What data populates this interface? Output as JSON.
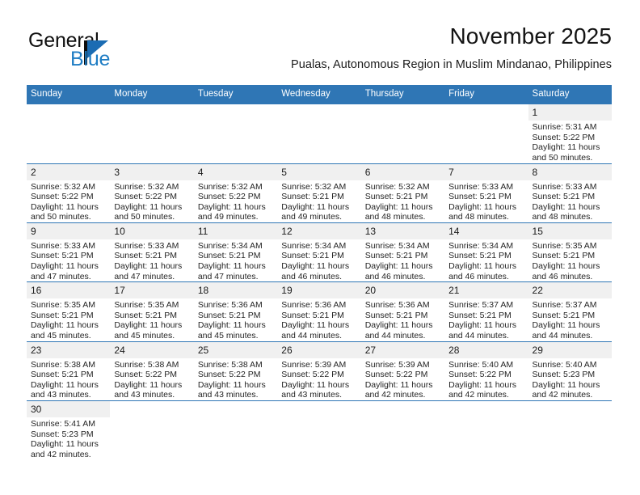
{
  "brand": {
    "name_top": "General",
    "name_bottom": "Blue",
    "flag_icon": "triangle-flag-icon",
    "accent_color": "#1b6cb3"
  },
  "header": {
    "month_title": "November 2025",
    "location": "Pualas, Autonomous Region in Muslim Mindanao, Philippines"
  },
  "calendar": {
    "header_color": "#2f76b5",
    "daynum_band_color": "#f0f0f0",
    "weekday_headers": [
      "Sunday",
      "Monday",
      "Tuesday",
      "Wednesday",
      "Thursday",
      "Friday",
      "Saturday"
    ],
    "labels": {
      "sunrise": "Sunrise:",
      "sunset": "Sunset:",
      "daylight": "Daylight:"
    },
    "weeks": [
      [
        {
          "day": "",
          "blank": true
        },
        {
          "day": "",
          "blank": true
        },
        {
          "day": "",
          "blank": true
        },
        {
          "day": "",
          "blank": true
        },
        {
          "day": "",
          "blank": true
        },
        {
          "day": "",
          "blank": true
        },
        {
          "day": "1",
          "sunrise": "Sunrise: 5:31 AM",
          "sunset": "Sunset: 5:22 PM",
          "daylight_1": "Daylight: 11 hours",
          "daylight_2": "and 50 minutes."
        }
      ],
      [
        {
          "day": "2",
          "sunrise": "Sunrise: 5:32 AM",
          "sunset": "Sunset: 5:22 PM",
          "daylight_1": "Daylight: 11 hours",
          "daylight_2": "and 50 minutes."
        },
        {
          "day": "3",
          "sunrise": "Sunrise: 5:32 AM",
          "sunset": "Sunset: 5:22 PM",
          "daylight_1": "Daylight: 11 hours",
          "daylight_2": "and 50 minutes."
        },
        {
          "day": "4",
          "sunrise": "Sunrise: 5:32 AM",
          "sunset": "Sunset: 5:22 PM",
          "daylight_1": "Daylight: 11 hours",
          "daylight_2": "and 49 minutes."
        },
        {
          "day": "5",
          "sunrise": "Sunrise: 5:32 AM",
          "sunset": "Sunset: 5:21 PM",
          "daylight_1": "Daylight: 11 hours",
          "daylight_2": "and 49 minutes."
        },
        {
          "day": "6",
          "sunrise": "Sunrise: 5:32 AM",
          "sunset": "Sunset: 5:21 PM",
          "daylight_1": "Daylight: 11 hours",
          "daylight_2": "and 48 minutes."
        },
        {
          "day": "7",
          "sunrise": "Sunrise: 5:33 AM",
          "sunset": "Sunset: 5:21 PM",
          "daylight_1": "Daylight: 11 hours",
          "daylight_2": "and 48 minutes."
        },
        {
          "day": "8",
          "sunrise": "Sunrise: 5:33 AM",
          "sunset": "Sunset: 5:21 PM",
          "daylight_1": "Daylight: 11 hours",
          "daylight_2": "and 48 minutes."
        }
      ],
      [
        {
          "day": "9",
          "sunrise": "Sunrise: 5:33 AM",
          "sunset": "Sunset: 5:21 PM",
          "daylight_1": "Daylight: 11 hours",
          "daylight_2": "and 47 minutes."
        },
        {
          "day": "10",
          "sunrise": "Sunrise: 5:33 AM",
          "sunset": "Sunset: 5:21 PM",
          "daylight_1": "Daylight: 11 hours",
          "daylight_2": "and 47 minutes."
        },
        {
          "day": "11",
          "sunrise": "Sunrise: 5:34 AM",
          "sunset": "Sunset: 5:21 PM",
          "daylight_1": "Daylight: 11 hours",
          "daylight_2": "and 47 minutes."
        },
        {
          "day": "12",
          "sunrise": "Sunrise: 5:34 AM",
          "sunset": "Sunset: 5:21 PM",
          "daylight_1": "Daylight: 11 hours",
          "daylight_2": "and 46 minutes."
        },
        {
          "day": "13",
          "sunrise": "Sunrise: 5:34 AM",
          "sunset": "Sunset: 5:21 PM",
          "daylight_1": "Daylight: 11 hours",
          "daylight_2": "and 46 minutes."
        },
        {
          "day": "14",
          "sunrise": "Sunrise: 5:34 AM",
          "sunset": "Sunset: 5:21 PM",
          "daylight_1": "Daylight: 11 hours",
          "daylight_2": "and 46 minutes."
        },
        {
          "day": "15",
          "sunrise": "Sunrise: 5:35 AM",
          "sunset": "Sunset: 5:21 PM",
          "daylight_1": "Daylight: 11 hours",
          "daylight_2": "and 46 minutes."
        }
      ],
      [
        {
          "day": "16",
          "sunrise": "Sunrise: 5:35 AM",
          "sunset": "Sunset: 5:21 PM",
          "daylight_1": "Daylight: 11 hours",
          "daylight_2": "and 45 minutes."
        },
        {
          "day": "17",
          "sunrise": "Sunrise: 5:35 AM",
          "sunset": "Sunset: 5:21 PM",
          "daylight_1": "Daylight: 11 hours",
          "daylight_2": "and 45 minutes."
        },
        {
          "day": "18",
          "sunrise": "Sunrise: 5:36 AM",
          "sunset": "Sunset: 5:21 PM",
          "daylight_1": "Daylight: 11 hours",
          "daylight_2": "and 45 minutes."
        },
        {
          "day": "19",
          "sunrise": "Sunrise: 5:36 AM",
          "sunset": "Sunset: 5:21 PM",
          "daylight_1": "Daylight: 11 hours",
          "daylight_2": "and 44 minutes."
        },
        {
          "day": "20",
          "sunrise": "Sunrise: 5:36 AM",
          "sunset": "Sunset: 5:21 PM",
          "daylight_1": "Daylight: 11 hours",
          "daylight_2": "and 44 minutes."
        },
        {
          "day": "21",
          "sunrise": "Sunrise: 5:37 AM",
          "sunset": "Sunset: 5:21 PM",
          "daylight_1": "Daylight: 11 hours",
          "daylight_2": "and 44 minutes."
        },
        {
          "day": "22",
          "sunrise": "Sunrise: 5:37 AM",
          "sunset": "Sunset: 5:21 PM",
          "daylight_1": "Daylight: 11 hours",
          "daylight_2": "and 44 minutes."
        }
      ],
      [
        {
          "day": "23",
          "sunrise": "Sunrise: 5:38 AM",
          "sunset": "Sunset: 5:21 PM",
          "daylight_1": "Daylight: 11 hours",
          "daylight_2": "and 43 minutes."
        },
        {
          "day": "24",
          "sunrise": "Sunrise: 5:38 AM",
          "sunset": "Sunset: 5:22 PM",
          "daylight_1": "Daylight: 11 hours",
          "daylight_2": "and 43 minutes."
        },
        {
          "day": "25",
          "sunrise": "Sunrise: 5:38 AM",
          "sunset": "Sunset: 5:22 PM",
          "daylight_1": "Daylight: 11 hours",
          "daylight_2": "and 43 minutes."
        },
        {
          "day": "26",
          "sunrise": "Sunrise: 5:39 AM",
          "sunset": "Sunset: 5:22 PM",
          "daylight_1": "Daylight: 11 hours",
          "daylight_2": "and 43 minutes."
        },
        {
          "day": "27",
          "sunrise": "Sunrise: 5:39 AM",
          "sunset": "Sunset: 5:22 PM",
          "daylight_1": "Daylight: 11 hours",
          "daylight_2": "and 42 minutes."
        },
        {
          "day": "28",
          "sunrise": "Sunrise: 5:40 AM",
          "sunset": "Sunset: 5:22 PM",
          "daylight_1": "Daylight: 11 hours",
          "daylight_2": "and 42 minutes."
        },
        {
          "day": "29",
          "sunrise": "Sunrise: 5:40 AM",
          "sunset": "Sunset: 5:23 PM",
          "daylight_1": "Daylight: 11 hours",
          "daylight_2": "and 42 minutes."
        }
      ],
      [
        {
          "day": "30",
          "sunrise": "Sunrise: 5:41 AM",
          "sunset": "Sunset: 5:23 PM",
          "daylight_1": "Daylight: 11 hours",
          "daylight_2": "and 42 minutes."
        },
        {
          "day": "",
          "blank": true
        },
        {
          "day": "",
          "blank": true
        },
        {
          "day": "",
          "blank": true
        },
        {
          "day": "",
          "blank": true
        },
        {
          "day": "",
          "blank": true
        },
        {
          "day": "",
          "blank": true
        }
      ]
    ]
  }
}
